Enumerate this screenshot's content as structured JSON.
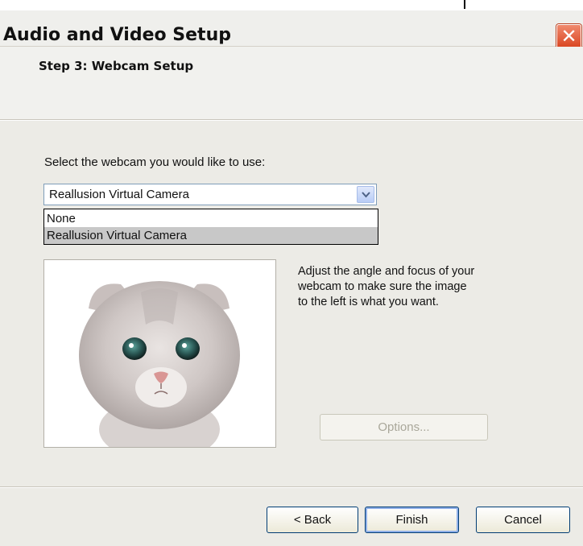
{
  "window": {
    "title": "Audio and Video Setup",
    "close_label": "✕"
  },
  "header": {
    "step_title": "Step 3: Webcam Setup"
  },
  "webcam": {
    "select_label": "Select the webcam you would like to use:",
    "selected": "Reallusion Virtual Camera",
    "options": [
      "None",
      "Reallusion Virtual Camera"
    ]
  },
  "preview": {
    "content": "kitten-face-image"
  },
  "hint": {
    "lines": [
      "Adjust the angle and focus of your",
      "webcam to make sure the image",
      "to the left is what you want."
    ]
  },
  "buttons": {
    "options": "Options...",
    "back": "< Back",
    "finish": "Finish",
    "cancel": "Cancel"
  },
  "colors": {
    "close_button": "#d9431e",
    "selected_item": "#c8c8c8"
  }
}
